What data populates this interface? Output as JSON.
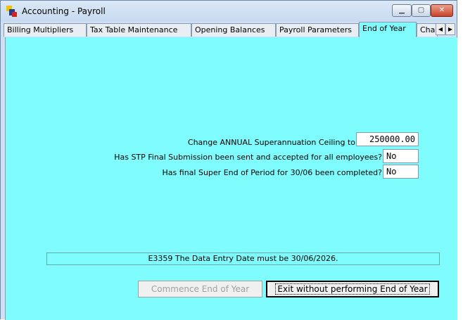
{
  "window": {
    "title": "Accounting - Payroll",
    "controls": {
      "minimize": "▁",
      "maximize": "▢",
      "close": "✕"
    }
  },
  "tabs": [
    {
      "label": "Billing Multipliers"
    },
    {
      "label": "Tax Table Maintenance"
    },
    {
      "label": "Opening Balances"
    },
    {
      "label": "Payroll Parameters"
    },
    {
      "label": "End of Year",
      "active": true
    },
    {
      "label": "Char"
    }
  ],
  "tab_scroll": {
    "left": "◀",
    "right": "▶"
  },
  "form": {
    "super_ceiling_label": "Change ANNUAL Superannuation Ceiling to",
    "super_ceiling_value": "250000.00",
    "stp_label": "Has STP Final Submission been sent and accepted for all employees?",
    "stp_value": "No",
    "super_period_label": "Has final Super End of Period for 30/06 been completed?",
    "super_period_value": "No"
  },
  "message": "E3359 The Data Entry Date must be 30/06/2026.",
  "buttons": {
    "commence": "Commence End of Year",
    "exit": "Exit without performing End of Year"
  },
  "colors": {
    "panel_background": "#7ffcfd",
    "title_bar": "#cfe0f2"
  }
}
